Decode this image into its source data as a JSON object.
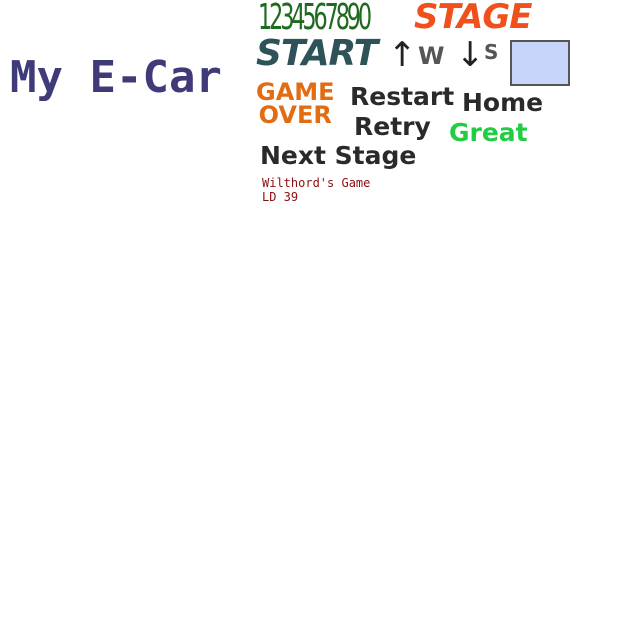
{
  "title": "My E-Car",
  "sprite_sheet": {
    "digits": "1234567890",
    "stage": "STAGE",
    "start": "START",
    "up_arrow": "↑",
    "key_w": "W",
    "down_arrow": "↓",
    "key_s": "S",
    "game_over_line1": "GAME",
    "game_over_line2": "OVER",
    "restart": "Restart",
    "retry": "Retry",
    "home": "Home",
    "great": "Great",
    "next_stage": "Next Stage",
    "credit_line1": "Wilthord's Game",
    "credit_line2": "LD 39"
  },
  "colors": {
    "title": "#3f3a78",
    "digits": "#1f6a1f",
    "stage": "#f0501a",
    "start": "#2d5258",
    "game_over": "#e26c14",
    "button_text": "#2a2a2a",
    "great": "#22cc44",
    "credit": "#8a1010",
    "swatch_fill": "#c7d5fb",
    "swatch_border": "#555555"
  }
}
